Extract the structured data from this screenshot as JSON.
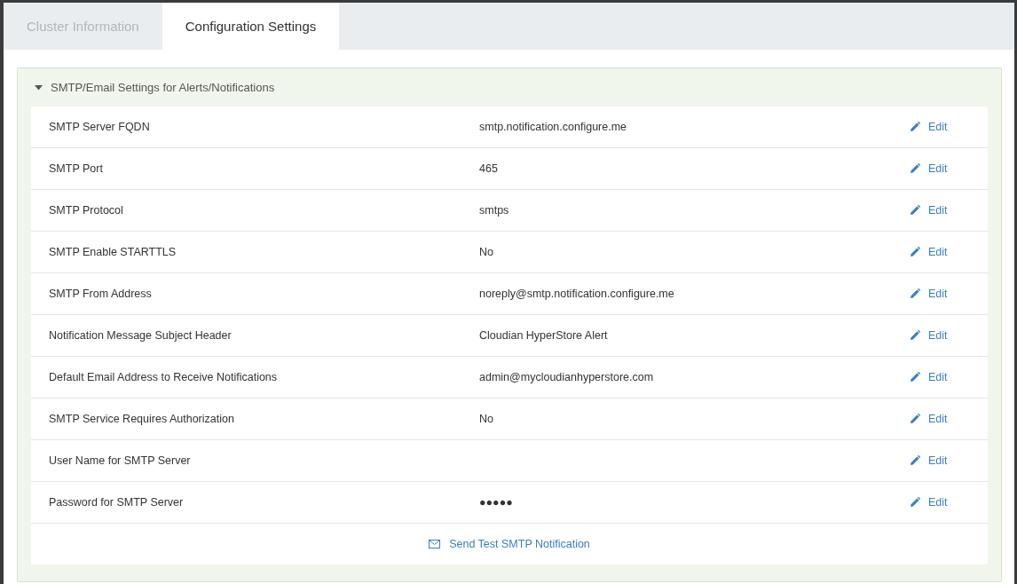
{
  "tabs": [
    {
      "label": "Cluster Information",
      "selected": false
    },
    {
      "label": "Configuration Settings",
      "selected": true
    }
  ],
  "section": {
    "title": "SMTP/Email Settings for Alerts/Notifications",
    "expanded": true,
    "rows": [
      {
        "label": "SMTP Server FQDN",
        "value": "smtp.notification.configure.me",
        "action": "Edit"
      },
      {
        "label": "SMTP Port",
        "value": "465",
        "action": "Edit"
      },
      {
        "label": "SMTP Protocol",
        "value": "smtps",
        "action": "Edit"
      },
      {
        "label": "SMTP Enable STARTTLS",
        "value": "No",
        "action": "Edit"
      },
      {
        "label": "SMTP From Address",
        "value": "noreply@smtp.notification.configure.me",
        "action": "Edit"
      },
      {
        "label": "Notification Message Subject Header",
        "value": "Cloudian HyperStore Alert",
        "action": "Edit"
      },
      {
        "label": "Default Email Address to Receive Notifications",
        "value": "admin@mycloudianhyperstore.com",
        "action": "Edit"
      },
      {
        "label": "SMTP Service Requires Authorization",
        "value": "No",
        "action": "Edit"
      },
      {
        "label": "User Name for SMTP Server",
        "action": "Edit"
      },
      {
        "label": "Password for SMTP Server",
        "value": "●●●●●",
        "action": "Edit"
      }
    ],
    "test_link": "Send Test SMTP Notification"
  }
}
